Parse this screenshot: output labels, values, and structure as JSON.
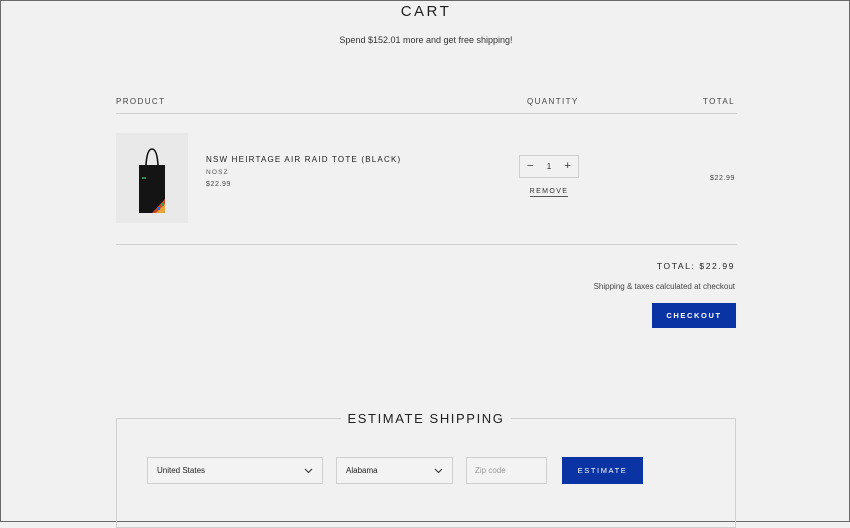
{
  "page": {
    "title": "CART",
    "shipping_message": "Spend $152.01 more and get free shipping!"
  },
  "table": {
    "headers": {
      "product": "PRODUCT",
      "quantity": "QUANTITY",
      "total": "TOTAL"
    }
  },
  "item": {
    "name": "NSW HEIRTAGE AIR RAID TOTE (BLACK)",
    "vendor": "NOSZ",
    "price": "$22.99",
    "quantity": "1",
    "remove_label": "REMOVE",
    "line_total": "$22.99"
  },
  "summary": {
    "total_label": "TOTAL: $22.99",
    "tax_note": "Shipping & taxes calculated at checkout",
    "checkout_label": "CHECKOUT"
  },
  "estimate": {
    "title": "ESTIMATE SHIPPING",
    "country": "United States",
    "province": "Alabama",
    "zip_placeholder": "Zip code",
    "button_label": "ESTIMATE"
  },
  "colors": {
    "accent": "#0a33a4",
    "background": "#f1f1f1",
    "rule": "#cfcfcf"
  },
  "icons": {
    "minus": "minus-icon",
    "plus": "plus-icon",
    "dropdown": "chevron-down-icon"
  }
}
